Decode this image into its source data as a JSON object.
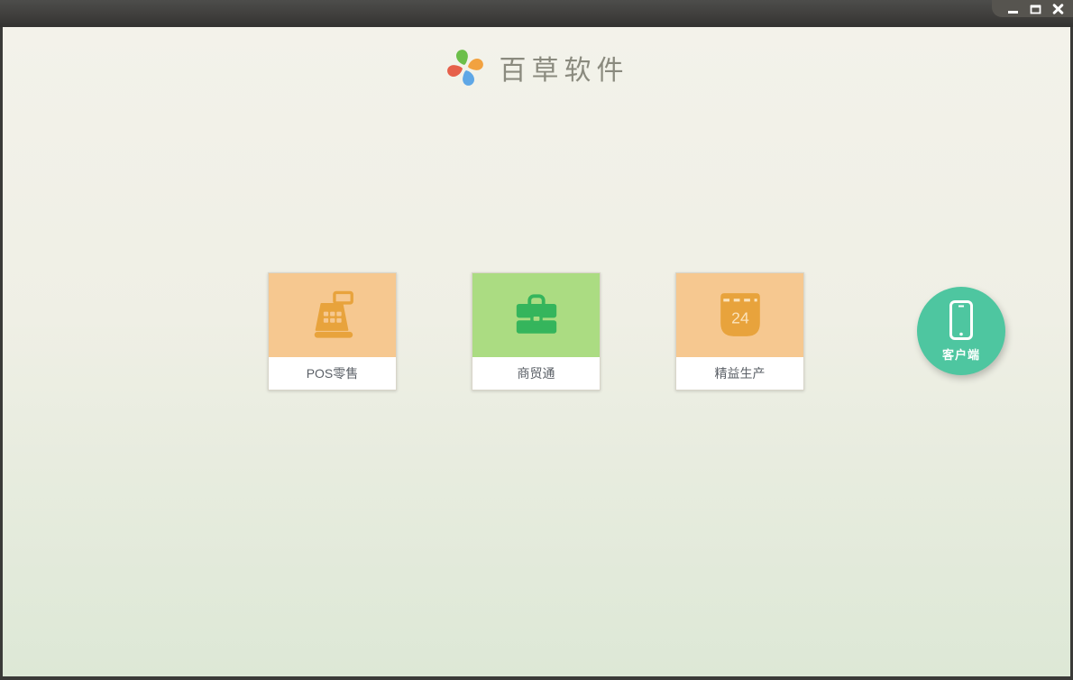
{
  "window": {
    "frame_color": "#3a3a38",
    "titlebar": {
      "bg_top": "#4d4d4b",
      "bg_bottom": "#333331",
      "tab_bg": "#56544f",
      "controls": [
        {
          "name": "minimize",
          "icon": "minimize-icon"
        },
        {
          "name": "maximize",
          "icon": "maximize-icon"
        },
        {
          "name": "close",
          "icon": "close-icon"
        }
      ]
    }
  },
  "header": {
    "app_name": "百草软件",
    "title_color": "#8a8a7e",
    "logo": {
      "icon": "pinwheel-logo-icon",
      "petal_colors": {
        "top": "#6cbf4a",
        "right": "#f2a240",
        "bottom": "#5fa7e6",
        "left": "#e6604a"
      }
    }
  },
  "products": [
    {
      "label": "POS零售",
      "icon": "cash-register-icon",
      "tile_bg": "#f6c890",
      "icon_color": "#e8a33c"
    },
    {
      "label": "商贸通",
      "icon": "briefcase-icon",
      "tile_bg": "#abdc82",
      "icon_color": "#35b55c"
    },
    {
      "label": "精益生产",
      "icon": "calendar-icon",
      "tile_bg": "#f6c890",
      "icon_color": "#e8a33c",
      "calendar_day": "24"
    }
  ],
  "client_button": {
    "label": "客户端",
    "icon": "smartphone-icon",
    "bg": "#4ec6a0",
    "text_color": "#ffffff"
  },
  "background": {
    "top": "#f3f2ea",
    "bottom": "#dde8d6"
  }
}
